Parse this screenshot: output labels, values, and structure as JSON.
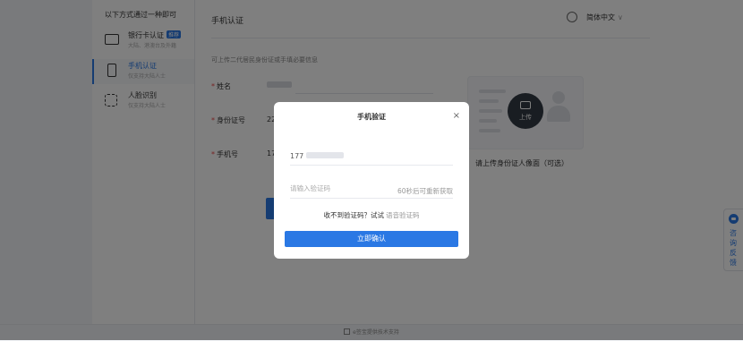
{
  "sidebar": {
    "heading": "以下方式通过一种即可",
    "items": [
      {
        "title": "银行卡认证",
        "tag": "推荐",
        "sub": "大陆、港澳台及外籍"
      },
      {
        "title": "手机认证",
        "sub": "仅支持大陆人士"
      },
      {
        "title": "人脸识别",
        "sub": "仅支持大陆人士"
      }
    ]
  },
  "main": {
    "title": "手机认证",
    "language": "简体中文",
    "hint": "可上传二代居民身份证或手填必要信息",
    "fields": [
      {
        "label": "姓名"
      },
      {
        "label": "身份证号",
        "value_prefix": "22"
      },
      {
        "label": "手机号",
        "value_prefix": "17"
      }
    ],
    "upload_label": "上传",
    "upload_caption": "请上传身份证人像面（可选）"
  },
  "modal": {
    "title": "手机验证",
    "close": "×",
    "phone_prefix": "177",
    "code_placeholder": "请输入验证码",
    "resend": "60秒后可重新获取",
    "no_code": "收不到验证码？试试",
    "voice_code": "语音验证码",
    "confirm": "立即确认"
  },
  "consult": {
    "label": "咨询反馈"
  },
  "footer": {
    "text": "e签宝提供技术支持"
  },
  "colors": {
    "accent": "#2a78e4",
    "overlay": "rgba(0,0,0,0.5)"
  }
}
